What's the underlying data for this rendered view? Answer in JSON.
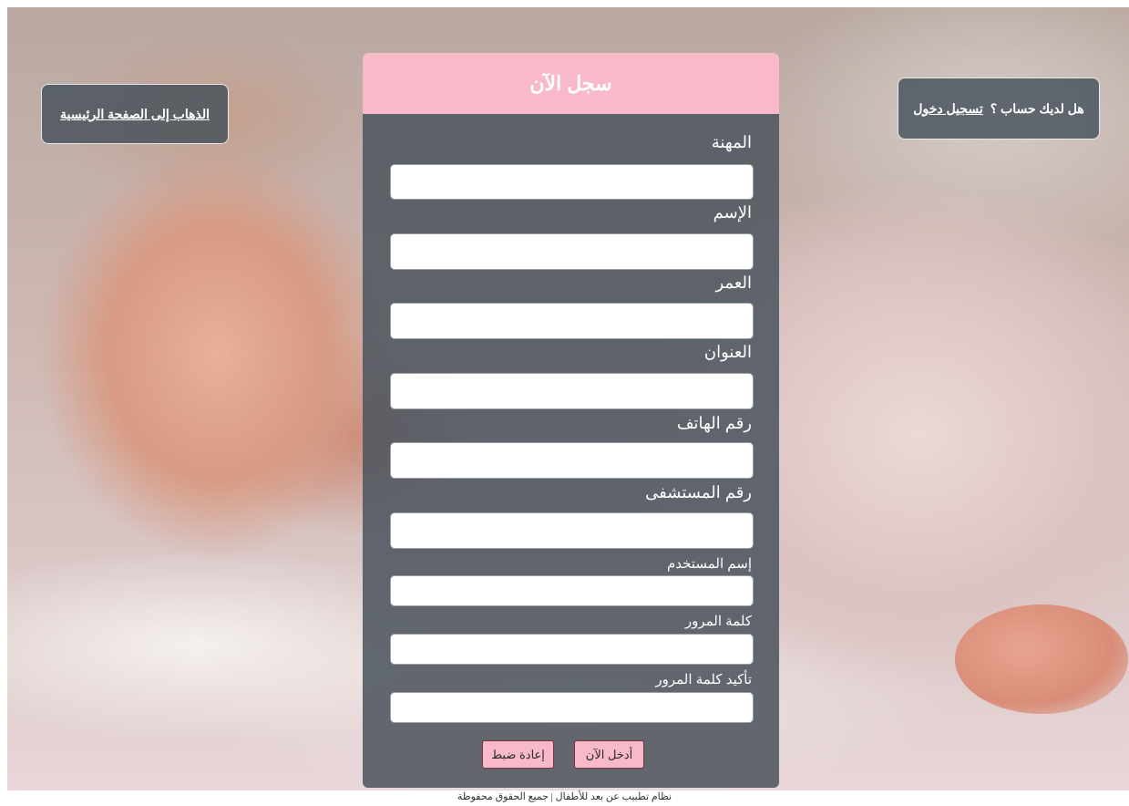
{
  "header": {
    "title": "سجل الآن"
  },
  "nav": {
    "home_link": "الذهاب إلى الصفحة الرئيسية",
    "have_account": "هل لديك حساب ؟",
    "login_link": "تسجيل دخول"
  },
  "form": {
    "fields": [
      {
        "label": "المهنة",
        "value": ""
      },
      {
        "label": "الإسم",
        "value": ""
      },
      {
        "label": "العمر",
        "value": ""
      },
      {
        "label": "العنوان",
        "value": ""
      },
      {
        "label": "رقم الهاتف",
        "value": ""
      },
      {
        "label": "رقم المستشفى",
        "value": ""
      },
      {
        "label": "إسم المستخدم",
        "value": ""
      },
      {
        "label": "كلمة المرور",
        "value": ""
      },
      {
        "label": "تأكيد كلمة المرور",
        "value": ""
      }
    ],
    "submit_label": "أدخل الآن",
    "reset_label": "إعادة ضبط"
  },
  "footer": {
    "text": "نظام تطبيب عن بعد للأطفال | جميع الحقوق محفوظة"
  }
}
